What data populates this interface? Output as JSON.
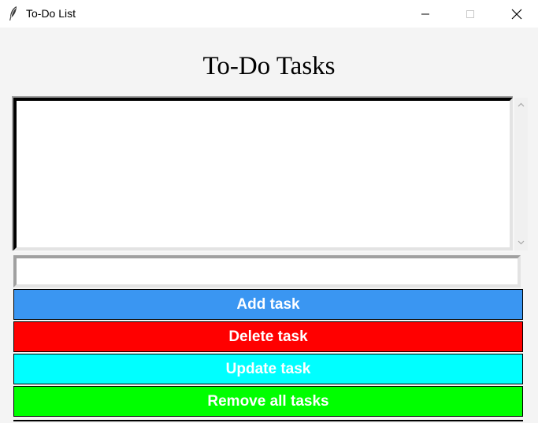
{
  "window": {
    "title": "To-Do List",
    "icon": "feather-icon"
  },
  "heading": "To-Do Tasks",
  "task_list": {
    "items": []
  },
  "task_input": {
    "value": "",
    "placeholder": ""
  },
  "buttons": {
    "add": {
      "label": "Add task",
      "color": "#3a96f2"
    },
    "delete": {
      "label": "Delete task",
      "color": "#ff0000"
    },
    "update": {
      "label": "Update task",
      "color": "#00ffff"
    },
    "remove_all": {
      "label": "Remove all tasks",
      "color": "#00ff00"
    }
  }
}
